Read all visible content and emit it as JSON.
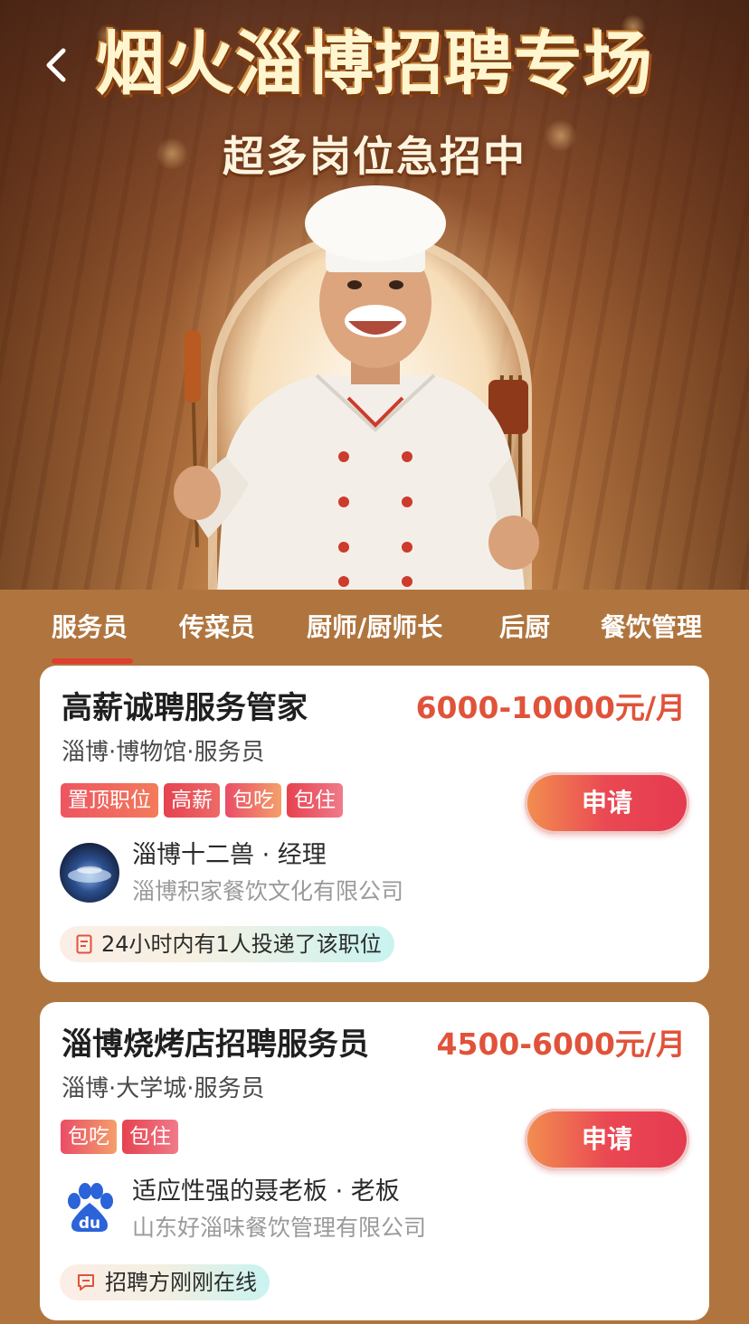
{
  "hero": {
    "title": "烟火淄博招聘专场",
    "subtitle": "超多岗位急招中"
  },
  "tabs": [
    {
      "label": "服务员",
      "active": true
    },
    {
      "label": "传菜员",
      "active": false
    },
    {
      "label": "厨师/厨师长",
      "active": false
    },
    {
      "label": "后厨",
      "active": false
    },
    {
      "label": "餐饮管理",
      "active": false
    }
  ],
  "jobs": [
    {
      "title": "高薪诚聘服务管家",
      "salary": "6000-10000元/月",
      "location": "淄博·博物馆·服务员",
      "tags": [
        "置顶职位",
        "高薪",
        "包吃",
        "包住"
      ],
      "apply_label": "申请",
      "recruiter": "淄博十二兽 · 经理",
      "company": "淄博积家餐饮文化有限公司",
      "avatar_icon": "restaurant-photo-avatar",
      "activity_icon": "document-icon",
      "activity": "24小时内有1人投递了该职位"
    },
    {
      "title": "淄博烧烤店招聘服务员",
      "salary": "4500-6000元/月",
      "location": "淄博·大学城·服务员",
      "tags": [
        "包吃",
        "包住"
      ],
      "apply_label": "申请",
      "recruiter": "适应性强的聂老板 · 老板",
      "company": "山东好淄味餐饮管理有限公司",
      "avatar_icon": "baidu-paw-logo",
      "avatar_text": "du",
      "activity_icon": "chat-bubble-icon",
      "activity": "招聘方刚刚在线"
    }
  ],
  "colors": {
    "page_background": "#b0753e",
    "salary": "#e0533a",
    "active_tab_underline": "#e03e2e",
    "apply_button": "#ea4853"
  }
}
